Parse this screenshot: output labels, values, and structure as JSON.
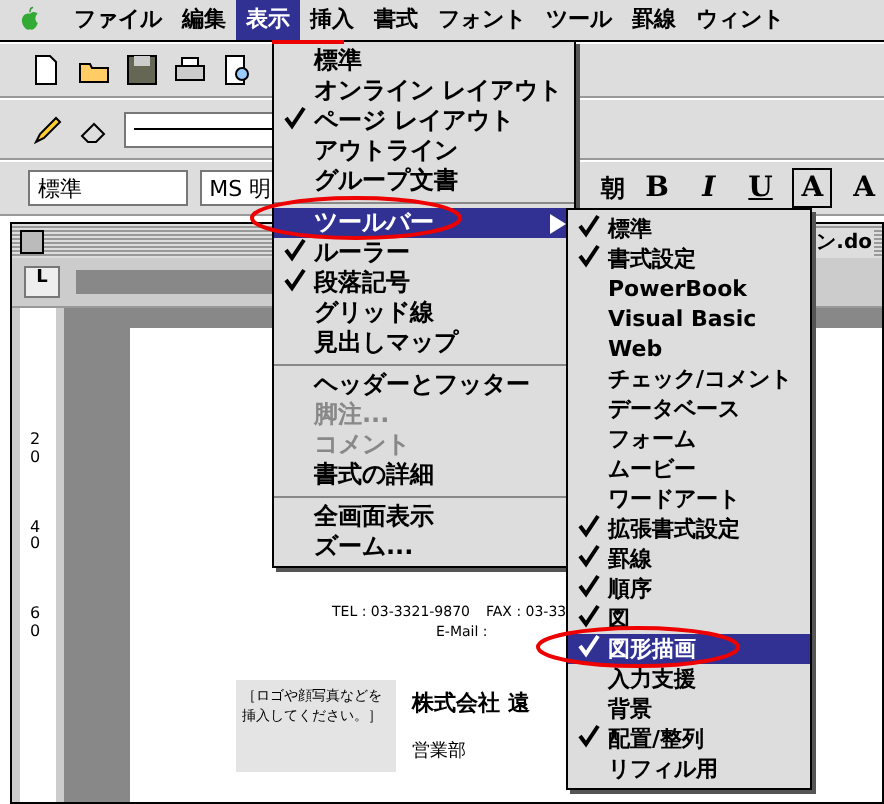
{
  "menubar": [
    {
      "label": "ファイル",
      "selected": false
    },
    {
      "label": "編集",
      "selected": false
    },
    {
      "label": "表示",
      "selected": true
    },
    {
      "label": "挿入",
      "selected": false
    },
    {
      "label": "書式",
      "selected": false
    },
    {
      "label": "フォント",
      "selected": false
    },
    {
      "label": "ツール",
      "selected": false
    },
    {
      "label": "罫線",
      "selected": false
    },
    {
      "label": "ウィント",
      "selected": false
    }
  ],
  "formatting": {
    "style": "標準",
    "font": "MS 明",
    "font_tail": "朝",
    "buttons": [
      "B",
      "I",
      "U",
      "A",
      "A"
    ]
  },
  "view_menu": [
    {
      "kind": "item",
      "label": "標準",
      "checked": false,
      "disabled": false,
      "selected": false,
      "submenu": false
    },
    {
      "kind": "item",
      "label": "オンライン レイアウト",
      "checked": false,
      "disabled": false,
      "selected": false,
      "submenu": false
    },
    {
      "kind": "item",
      "label": "ページ レイアウト",
      "checked": true,
      "disabled": false,
      "selected": false,
      "submenu": false
    },
    {
      "kind": "item",
      "label": "アウトライン",
      "checked": false,
      "disabled": false,
      "selected": false,
      "submenu": false
    },
    {
      "kind": "item",
      "label": "グループ文書",
      "checked": false,
      "disabled": false,
      "selected": false,
      "submenu": false
    },
    {
      "kind": "separator"
    },
    {
      "kind": "item",
      "label": "ツールバー",
      "checked": false,
      "disabled": false,
      "selected": true,
      "submenu": true
    },
    {
      "kind": "item",
      "label": "ルーラー",
      "checked": true,
      "disabled": false,
      "selected": false,
      "submenu": false
    },
    {
      "kind": "item",
      "label": "段落記号",
      "checked": true,
      "disabled": false,
      "selected": false,
      "submenu": false
    },
    {
      "kind": "item",
      "label": "グリッド線",
      "checked": false,
      "disabled": false,
      "selected": false,
      "submenu": false
    },
    {
      "kind": "item",
      "label": "見出しマップ",
      "checked": false,
      "disabled": false,
      "selected": false,
      "submenu": false
    },
    {
      "kind": "separator"
    },
    {
      "kind": "item",
      "label": "ヘッダーとフッター",
      "checked": false,
      "disabled": false,
      "selected": false,
      "submenu": false
    },
    {
      "kind": "item",
      "label": "脚注...",
      "checked": false,
      "disabled": true,
      "selected": false,
      "submenu": false
    },
    {
      "kind": "item",
      "label": "コメント",
      "checked": false,
      "disabled": true,
      "selected": false,
      "submenu": false
    },
    {
      "kind": "item",
      "label": "書式の詳細",
      "checked": false,
      "disabled": false,
      "selected": false,
      "submenu": false
    },
    {
      "kind": "separator"
    },
    {
      "kind": "item",
      "label": "全画面表示",
      "checked": false,
      "disabled": false,
      "selected": false,
      "submenu": false
    },
    {
      "kind": "item",
      "label": "ズーム...",
      "checked": false,
      "disabled": false,
      "selected": false,
      "submenu": false
    }
  ],
  "toolbars_submenu": [
    {
      "label": "標準",
      "checked": true,
      "selected": false
    },
    {
      "label": "書式設定",
      "checked": true,
      "selected": false
    },
    {
      "label": "PowerBook",
      "checked": false,
      "selected": false
    },
    {
      "label": "Visual Basic",
      "checked": false,
      "selected": false
    },
    {
      "label": "Web",
      "checked": false,
      "selected": false
    },
    {
      "label": "チェック/コメント",
      "checked": false,
      "selected": false
    },
    {
      "label": "データベース",
      "checked": false,
      "selected": false
    },
    {
      "label": "フォーム",
      "checked": false,
      "selected": false
    },
    {
      "label": "ムービー",
      "checked": false,
      "selected": false
    },
    {
      "label": "ワードアート",
      "checked": false,
      "selected": false
    },
    {
      "label": "拡張書式設定",
      "checked": true,
      "selected": false
    },
    {
      "label": "罫線",
      "checked": true,
      "selected": false
    },
    {
      "label": "順序",
      "checked": true,
      "selected": false
    },
    {
      "label": "図",
      "checked": true,
      "selected": false
    },
    {
      "label": "図形描画",
      "checked": true,
      "selected": true
    },
    {
      "label": "入力支援",
      "checked": false,
      "selected": false
    },
    {
      "label": "背景",
      "checked": false,
      "selected": false
    },
    {
      "label": "配置/整列",
      "checked": true,
      "selected": false
    },
    {
      "label": "リフィル用",
      "checked": false,
      "selected": false
    }
  ],
  "document": {
    "title": "ン.do",
    "tab_stop": "L",
    "ruler_numbers": [
      "20",
      "40",
      "60"
    ],
    "tel": "TEL : 03-3321-9870",
    "fax": "FAX : 03-33",
    "email": "E-Mail :",
    "logo_note": "［ロゴや顔写真などを挿入してください。］",
    "company": "株式会社 遠",
    "department": "営業部"
  }
}
